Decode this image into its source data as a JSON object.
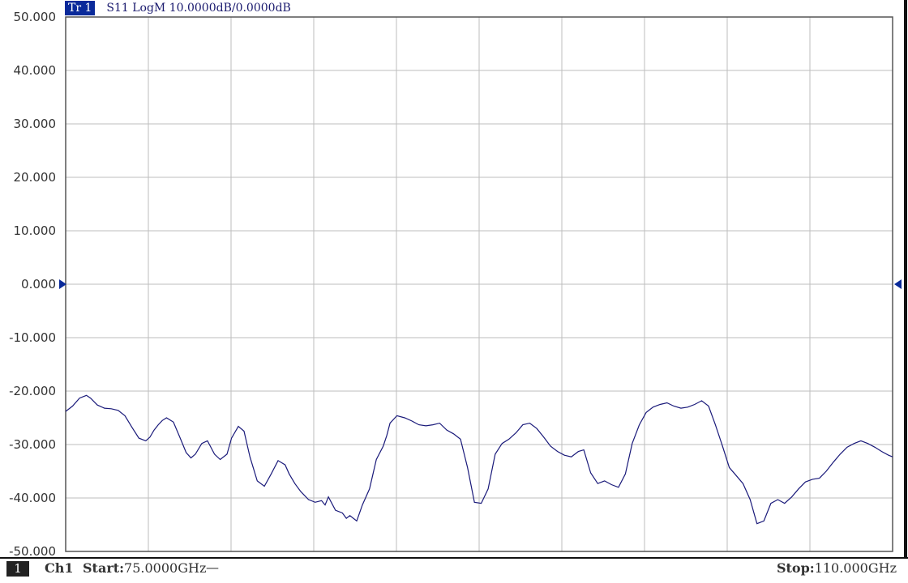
{
  "header": {
    "trace_badge": "Tr 1",
    "trace_info": "S11 LogM 10.0000dB/0.0000dB"
  },
  "footer": {
    "channel_number": "1",
    "channel_name": "Ch1",
    "start_label": "Start:",
    "start_value": "75.0000GHz",
    "start_dash": "—",
    "stop_label": "Stop:",
    "stop_value": "110.000GHz"
  },
  "colors": {
    "trace": "#1a1a7a",
    "grid": "#bdbdbd",
    "marker": "#0a2a9a"
  },
  "chart_data": {
    "type": "line",
    "title": "",
    "xlabel": "",
    "ylabel": "",
    "xlim": [
      75.0,
      110.0
    ],
    "ylim": [
      -50,
      50
    ],
    "x_divisions": 10,
    "y_divisions": 10,
    "grid": true,
    "yticks": [
      "50.000",
      "40.000",
      "30.000",
      "20.000",
      "10.000",
      "0.000",
      "-10.000",
      "-20.000",
      "-30.000",
      "-40.000",
      "-50.000"
    ],
    "reference_level": 0.0,
    "series": [
      {
        "x": [
          75.0,
          75.29,
          75.59,
          75.88,
          76.05,
          76.34,
          76.64,
          76.93,
          77.22,
          77.51,
          77.81,
          78.1,
          78.39,
          78.57,
          78.74,
          78.92,
          79.09,
          79.27,
          79.56,
          79.85,
          80.1,
          80.3,
          80.49,
          80.76,
          81.0,
          81.3,
          81.54,
          81.83,
          82.02,
          82.31,
          82.55,
          82.8,
          83.11,
          83.41,
          83.7,
          83.99,
          84.29,
          84.46,
          84.7,
          84.95,
          85.28,
          85.56,
          85.83,
          85.98,
          86.12,
          86.42,
          86.71,
          86.88,
          87.03,
          87.32,
          87.56,
          87.86,
          88.15,
          88.44,
          88.59,
          88.73,
          89.02,
          89.35,
          89.66,
          89.95,
          90.25,
          90.54,
          90.83,
          91.13,
          91.42,
          91.71,
          92.01,
          92.3,
          92.59,
          92.88,
          93.18,
          93.47,
          93.76,
          94.06,
          94.35,
          94.64,
          94.94,
          95.23,
          95.52,
          95.82,
          96.11,
          96.4,
          96.7,
          96.93,
          97.22,
          97.52,
          97.81,
          98.1,
          98.4,
          98.69,
          98.98,
          99.28,
          99.57,
          99.86,
          100.16,
          100.45,
          100.74,
          101.04,
          101.33,
          101.62,
          101.92,
          102.21,
          102.5,
          102.8,
          103.09,
          103.38,
          103.67,
          103.97,
          104.26,
          104.55,
          104.85,
          105.14,
          105.43,
          105.73,
          106.02,
          106.31,
          106.61,
          106.9,
          107.19,
          107.49,
          107.78,
          108.07,
          108.37,
          108.66,
          108.95,
          109.25,
          109.54,
          109.83,
          110.0
        ],
        "y": [
          -23.8,
          -22.8,
          -21.3,
          -20.8,
          -21.3,
          -22.6,
          -23.2,
          -23.3,
          -23.6,
          -24.6,
          -26.8,
          -28.8,
          -29.3,
          -28.6,
          -27.3,
          -26.3,
          -25.5,
          -25.0,
          -25.8,
          -28.8,
          -31.5,
          -32.5,
          -31.8,
          -29.8,
          -29.3,
          -31.8,
          -32.8,
          -31.8,
          -28.8,
          -26.6,
          -27.5,
          -32.3,
          -36.8,
          -37.8,
          -35.5,
          -33.0,
          -33.8,
          -35.5,
          -37.3,
          -38.8,
          -40.3,
          -40.8,
          -40.5,
          -41.3,
          -39.8,
          -42.3,
          -42.8,
          -43.8,
          -43.3,
          -44.3,
          -41.3,
          -38.3,
          -32.8,
          -30.3,
          -28.3,
          -26.0,
          -24.6,
          -25.0,
          -25.6,
          -26.3,
          -26.5,
          -26.3,
          -26.0,
          -27.3,
          -28.0,
          -29.0,
          -34.3,
          -40.8,
          -41.0,
          -38.3,
          -31.8,
          -29.8,
          -29.0,
          -27.8,
          -26.3,
          -26.0,
          -27.0,
          -28.6,
          -30.3,
          -31.3,
          -32.0,
          -32.3,
          -31.3,
          -31.0,
          -35.3,
          -37.3,
          -36.8,
          -37.5,
          -38.0,
          -35.5,
          -29.8,
          -26.3,
          -24.0,
          -23.0,
          -22.5,
          -22.2,
          -22.8,
          -23.2,
          -23.0,
          -22.5,
          -21.8,
          -22.8,
          -26.3,
          -30.3,
          -34.3,
          -35.8,
          -37.3,
          -40.3,
          -44.8,
          -44.3,
          -41.0,
          -40.3,
          -41.0,
          -39.8,
          -38.3,
          -37.0,
          -36.5,
          -36.3,
          -35.0,
          -33.3,
          -31.8,
          -30.5,
          -29.8,
          -29.3,
          -29.8,
          -30.5,
          -31.3,
          -32.0,
          -32.3
        ]
      }
    ]
  }
}
